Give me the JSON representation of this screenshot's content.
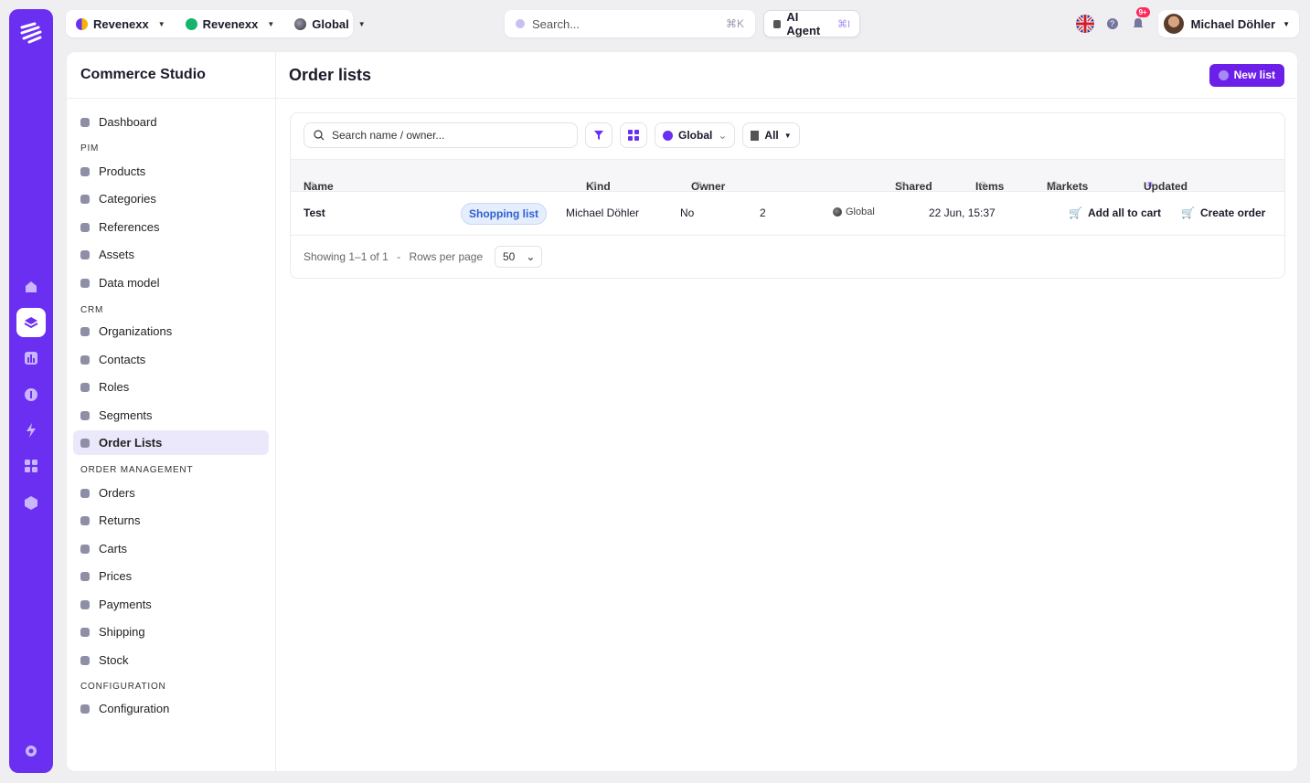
{
  "colors": {
    "brand": "#6b2ff2",
    "accent": "#6b1fe8",
    "pill_bg": "#e5eefc",
    "pill_fg": "#2f5fd0",
    "notification": "#ff2a5a"
  },
  "rail": {
    "icons": [
      "logo-icon",
      "store-icon",
      "layers-icon",
      "chart-icon",
      "plug-icon",
      "bolt-icon",
      "apps-icon",
      "cube-icon",
      "settings-icon"
    ],
    "active": "layers-icon"
  },
  "topbar": {
    "org": "Revenexx",
    "workspace": "Revenexx",
    "market": "Global",
    "search_placeholder": "Search...",
    "search_shortcut": "⌘K",
    "ai_agent": "AI Agent",
    "ai_shortcut": "⌘I",
    "notifications": "9+",
    "user_name": "Michael Döhler"
  },
  "sidebar": {
    "title": "Commerce Studio",
    "dashboard": "Dashboard",
    "sections": {
      "pim": "PIM",
      "crm": "CRM",
      "order_management": "ORDER MANAGEMENT",
      "configuration": "CONFIGURATION"
    },
    "items": {
      "products": "Products",
      "categories": "Categories",
      "references": "References",
      "assets": "Assets",
      "data_model": "Data model",
      "organizations": "Organizations",
      "contacts": "Contacts",
      "roles": "Roles",
      "segments": "Segments",
      "order_lists": "Order Lists",
      "orders": "Orders",
      "returns": "Returns",
      "carts": "Carts",
      "prices": "Prices",
      "payments": "Payments",
      "shipping": "Shipping",
      "stock": "Stock",
      "configuration": "Configuration"
    },
    "active": "Order Lists"
  },
  "main": {
    "title": "Order lists",
    "new_button": "New list",
    "filters": {
      "search_placeholder": "Search name / owner...",
      "market": "Global",
      "kind": "All"
    },
    "columns": {
      "name": "Name",
      "kind": "Kind",
      "owner": "Owner",
      "shared": "Shared",
      "items": "Items",
      "markets": "Markets",
      "updated": "Updated"
    },
    "rows": [
      {
        "name": "Test",
        "kind": "Shopping list",
        "owner": "Michael Döhler",
        "shared": "No",
        "items": "2",
        "markets": "Global",
        "updated": "22 Jun, 15:37",
        "action_add": "Add all to cart",
        "action_create": "Create order"
      }
    ],
    "footer": {
      "showing": "Showing 1–1 of 1",
      "separator": "-",
      "rows_per_page_label": "Rows per page",
      "rows_per_page": "50"
    }
  }
}
